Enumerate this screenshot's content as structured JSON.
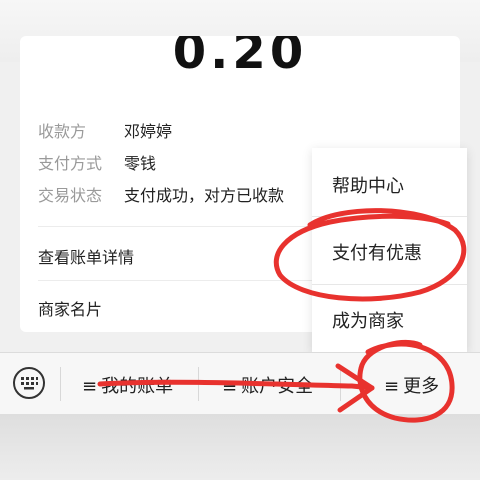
{
  "payment": {
    "amount": "0.20",
    "rows": [
      {
        "label": "收款方",
        "value": "邓婷婷"
      },
      {
        "label": "支付方式",
        "value": "零钱"
      },
      {
        "label": "交易状态",
        "value": "支付成功，对方已收款"
      }
    ],
    "links": [
      "查看账单详情",
      "商家名片"
    ]
  },
  "more_menu": {
    "items": [
      "帮助中心",
      "支付有优惠",
      "成为商家"
    ]
  },
  "bottom_bar": {
    "keyboard_icon": "keyboard-icon",
    "items": [
      {
        "icon": "≡",
        "label": "我的账单"
      },
      {
        "icon": "≡",
        "label": "账户安全"
      },
      {
        "icon": "≡",
        "label": "更多"
      }
    ]
  },
  "annotation": {
    "color": "#e8322e"
  }
}
